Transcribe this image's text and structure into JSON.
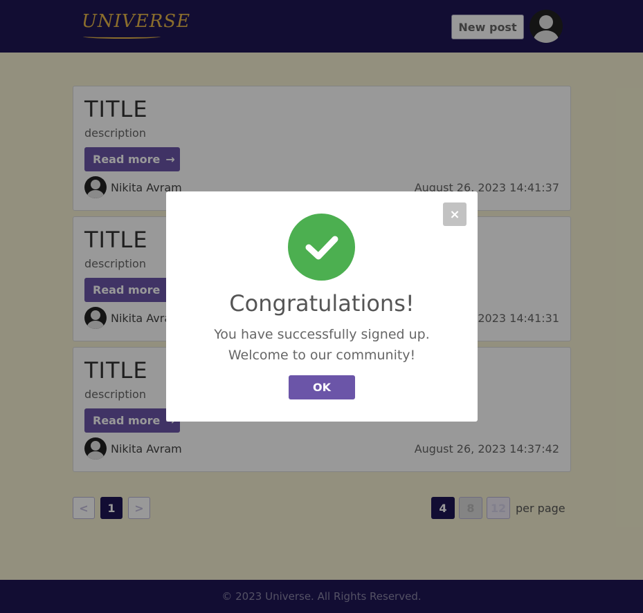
{
  "header": {
    "logo_text": "UNIVERSE",
    "new_post_label": "New post"
  },
  "posts": [
    {
      "title": "TITLE",
      "description": "description",
      "read_more": "Read more",
      "author": "Nikita Avram",
      "date": "August 26, 2023 14:41:37"
    },
    {
      "title": "TITLE",
      "description": "description",
      "read_more": "Read more",
      "author": "Nikita Avram",
      "date": "August 26, 2023 14:41:31"
    },
    {
      "title": "TITLE",
      "description": "description",
      "read_more": "Read more",
      "author": "Nikita Avram",
      "date": "August 26, 2023 14:37:42"
    }
  ],
  "pagination": {
    "prev": "<",
    "current": "1",
    "next": ">",
    "per_page_options": [
      "4",
      "8",
      "12"
    ],
    "per_page_label": "per page"
  },
  "footer": {
    "text": "© 2023 Universe. All Rights Reserved."
  },
  "modal": {
    "close": "×",
    "title": "Congratulations!",
    "message_line1": "You have successfully signed up.",
    "message_line2": "Welcome to our community!",
    "ok_label": "OK"
  },
  "colors": {
    "header_bg": "#1e1755",
    "accent": "#6b55a8",
    "success": "#4caf50",
    "page_bg": "#f5f1d2"
  }
}
